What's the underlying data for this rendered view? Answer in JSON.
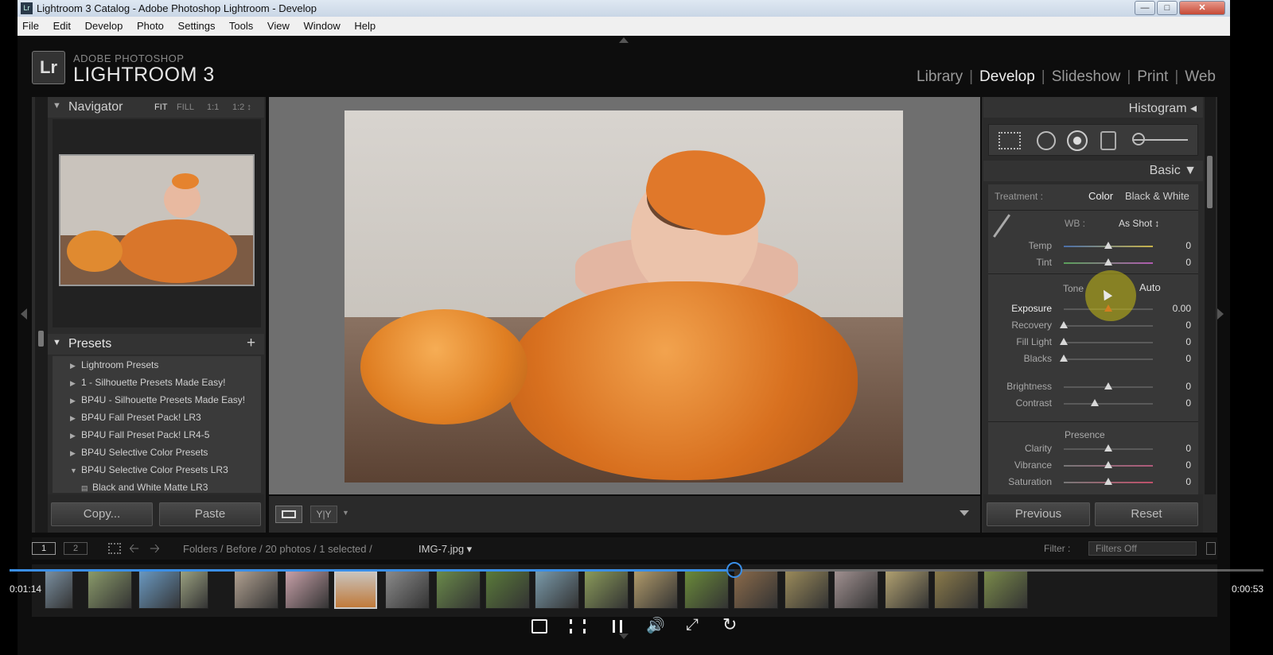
{
  "window": {
    "title": "Lightroom 3 Catalog - Adobe Photoshop Lightroom - Develop",
    "app_icon": "Lr",
    "controls": [
      "minimize-icon",
      "maximize-icon",
      "close-icon"
    ]
  },
  "menu": [
    "File",
    "Edit",
    "Develop",
    "Photo",
    "Settings",
    "Tools",
    "View",
    "Window",
    "Help"
  ],
  "brand": {
    "logo": "Lr",
    "top": "ADOBE PHOTOSHOP",
    "main": "LIGHTROOM 3"
  },
  "modules": {
    "library": "Library",
    "develop": "Develop",
    "slideshow": "Slideshow",
    "print": "Print",
    "web": "Web",
    "separator": "|"
  },
  "navigator": {
    "title": "Navigator",
    "fit": "FIT",
    "fill": "FILL",
    "one": "1:1",
    "ratio": "1:2 ↕"
  },
  "presets": {
    "title": "Presets",
    "add": "+",
    "items": [
      {
        "label": "Lightroom Presets",
        "arrow": "▶"
      },
      {
        "label": "1 - Silhouette Presets Made Easy!",
        "arrow": "▶"
      },
      {
        "label": "BP4U - Silhouette Presets Made Easy!",
        "arrow": "▶"
      },
      {
        "label": "BP4U Fall Preset Pack! LR3",
        "arrow": "▶"
      },
      {
        "label": "BP4U Fall Preset Pack! LR4-5",
        "arrow": "▶"
      },
      {
        "label": "BP4U Selective Color Presets",
        "arrow": "▶"
      },
      {
        "label": "BP4U Selective Color Presets LR3",
        "arrow": "▼"
      },
      {
        "label": "Black and White Matte LR3",
        "arrow": "▤"
      }
    ]
  },
  "left_buttons": {
    "copy": "Copy...",
    "paste": "Paste"
  },
  "histogram": {
    "title": "Histogram ◂"
  },
  "basic": {
    "title": "Basic ▼",
    "treatment_label": "Treatment :",
    "color": "Color",
    "bw": "Black & White",
    "wb_label": "WB :",
    "wb_value": "As Shot ↕",
    "tone": "Tone",
    "auto": "Auto",
    "presence": "Presence",
    "sliders": [
      {
        "label": "Temp",
        "value": "0",
        "position": 0.5
      },
      {
        "label": "Tint",
        "value": "0",
        "position": 0.5
      },
      {
        "label": "Exposure",
        "value": "0.00",
        "position": 0.5
      },
      {
        "label": "Recovery",
        "value": "0",
        "position": 0.0
      },
      {
        "label": "Fill Light",
        "value": "0",
        "position": 0.0
      },
      {
        "label": "Blacks",
        "value": "0",
        "position": 0.0
      },
      {
        "label": "Brightness",
        "value": "0",
        "position": 0.5
      },
      {
        "label": "Contrast",
        "value": "0",
        "position": 0.35
      },
      {
        "label": "Clarity",
        "value": "0",
        "position": 0.5
      },
      {
        "label": "Vibrance",
        "value": "0",
        "position": 0.5
      },
      {
        "label": "Saturation",
        "value": "0",
        "position": 0.5
      }
    ]
  },
  "right_buttons": {
    "previous": "Previous",
    "reset": "Reset"
  },
  "filmstrip": {
    "view1": "1",
    "view2": "2",
    "breadcrumb": "Folders / Before / 20 photos / 1 selected /",
    "filename": "IMG-7.jpg ▾",
    "filter_label": "Filter :",
    "filter_value": "Filters Off",
    "thumb_count": 20
  },
  "video": {
    "elapsed": "0:01:14",
    "remaining": "0:00:53",
    "progress": 0.578
  }
}
